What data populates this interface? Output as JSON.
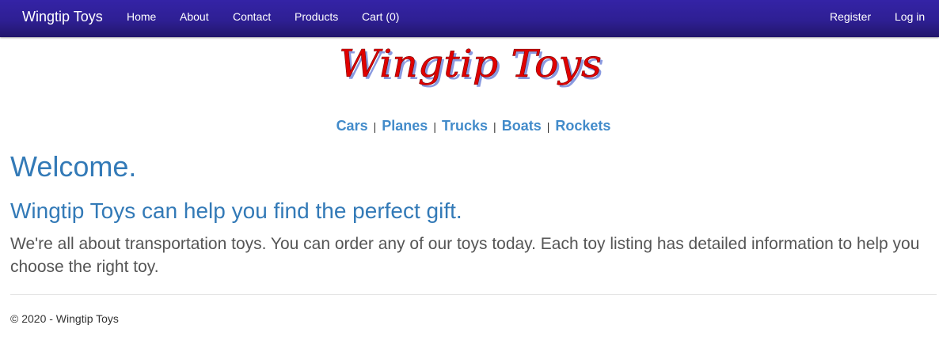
{
  "navbar": {
    "brand": "Wingtip Toys",
    "links": [
      "Home",
      "About",
      "Contact",
      "Products",
      "Cart (0)"
    ],
    "account_links": [
      "Register",
      "Log in"
    ]
  },
  "logo": {
    "text": "Wingtip Toys",
    "fill_color": "#e00000",
    "shadow_color": "#8a9ae0"
  },
  "categories": [
    "Cars",
    "Planes",
    "Trucks",
    "Boats",
    "Rockets"
  ],
  "category_separator": "|",
  "main": {
    "heading": "Welcome.",
    "subheading": "Wingtip Toys can help you find the perfect gift.",
    "paragraph": "We're all about transportation toys. You can order any of our toys today. Each toy listing has detailed information to help you choose the right toy."
  },
  "footer": {
    "text": "© 2020 - Wingtip Toys"
  },
  "colors": {
    "navbar": "#2e1f93",
    "link": "#428bca",
    "heading": "#337ab7",
    "body_text": "#555555"
  }
}
